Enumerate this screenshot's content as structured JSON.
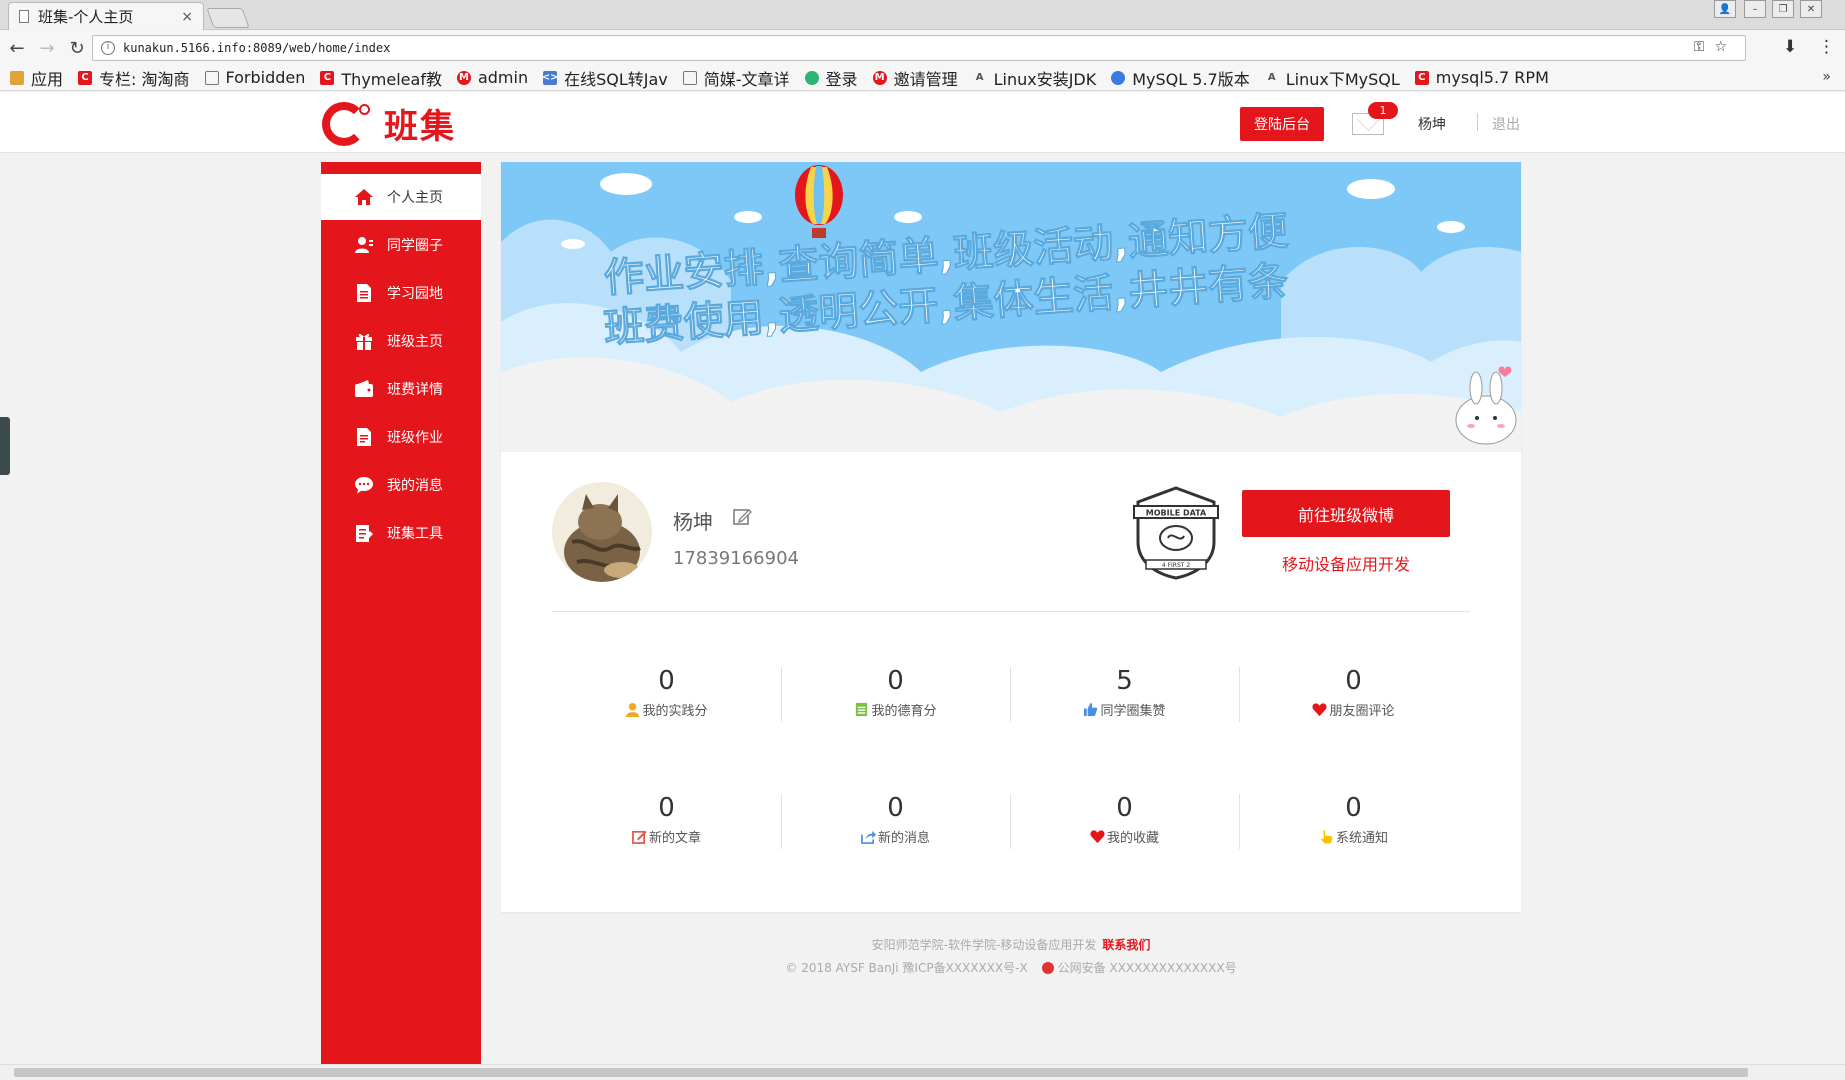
{
  "browser": {
    "tab_title": "班集-个人主页",
    "tab_close": "×",
    "url": "kunakun.5166.info:8089/web/home/index",
    "bookmarks": [
      {
        "label": "应用",
        "color": "#d23"
      },
      {
        "label": "专栏: 淘淘商",
        "color": "#e5161b"
      },
      {
        "label": "Forbidden",
        "color": "#fff"
      },
      {
        "label": "Thymeleaf教",
        "color": "#e5161b"
      },
      {
        "label": "admin",
        "color": "#e5161b"
      },
      {
        "label": "在线SQL转Jav",
        "color": "#4a7bd3"
      },
      {
        "label": "简媒-文章详",
        "color": "#fff"
      },
      {
        "label": "登录",
        "color": "#2bb673"
      },
      {
        "label": "邀请管理",
        "color": "#e5161b"
      },
      {
        "label": "Linux安装JDK",
        "color": "#888"
      },
      {
        "label": "MySQL 5.7版本",
        "color": "#3b7be0"
      },
      {
        "label": "Linux下MySQL",
        "color": "#888"
      },
      {
        "label": "mysql5.7 RPM",
        "color": "#e5161b"
      }
    ],
    "more": "»"
  },
  "header": {
    "logo_text": "班集",
    "admin_button": "登陆后台",
    "message_count": "1",
    "username": "杨坤",
    "logout": "退出"
  },
  "sidebar": {
    "items": [
      {
        "label": "个人主页",
        "icon": "home-icon",
        "active": true
      },
      {
        "label": "同学圈子",
        "icon": "user-circle-icon"
      },
      {
        "label": "学习园地",
        "icon": "document-icon"
      },
      {
        "label": "班级主页",
        "icon": "gift-icon"
      },
      {
        "label": "班费详情",
        "icon": "wallet-icon"
      },
      {
        "label": "班级作业",
        "icon": "homework-icon"
      },
      {
        "label": "我的消息",
        "icon": "chat-icon"
      },
      {
        "label": "班集工具",
        "icon": "tools-icon"
      }
    ]
  },
  "banner": {
    "line1": "作业安排,查询简单,班级活动,通知方便",
    "line2": "班费使用,透明公开,集体生活,井井有条"
  },
  "profile": {
    "name": "杨坤",
    "phone": "17839166904",
    "weibo_button": "前往班级微博",
    "class_name": "移动设备应用开发",
    "class_logo_text": "MOBILE DATA",
    "class_logo_sub": "4 FIRST 2"
  },
  "stats": [
    {
      "value": "0",
      "label": "我的实践分",
      "icon": "person-icon",
      "color": "#f5a623"
    },
    {
      "value": "0",
      "label": "我的德育分",
      "icon": "list-icon",
      "color": "#7ac143"
    },
    {
      "value": "5",
      "label": "同学圈集赞",
      "icon": "thumbs-up-icon",
      "color": "#4a90e2"
    },
    {
      "value": "0",
      "label": "朋友圈评论",
      "icon": "heart-icon",
      "color": "#e5161b"
    },
    {
      "value": "0",
      "label": "新的文章",
      "icon": "edit-icon",
      "color": "#e0554a"
    },
    {
      "value": "0",
      "label": "新的消息",
      "icon": "share-icon",
      "color": "#4a90e2"
    },
    {
      "value": "0",
      "label": "我的收藏",
      "icon": "heart-icon",
      "color": "#e5161b"
    },
    {
      "value": "0",
      "label": "系统通知",
      "icon": "hand-icon",
      "color": "#f5c400"
    }
  ],
  "footer": {
    "line1": "安阳师范学院-软件学院-移动设备应用开发",
    "contact": "联系我们",
    "copyright": "© 2018 AYSF BanJi 豫ICP备XXXXXXX号-X",
    "police": "公网安备 XXXXXXXXXXXXXX号"
  }
}
